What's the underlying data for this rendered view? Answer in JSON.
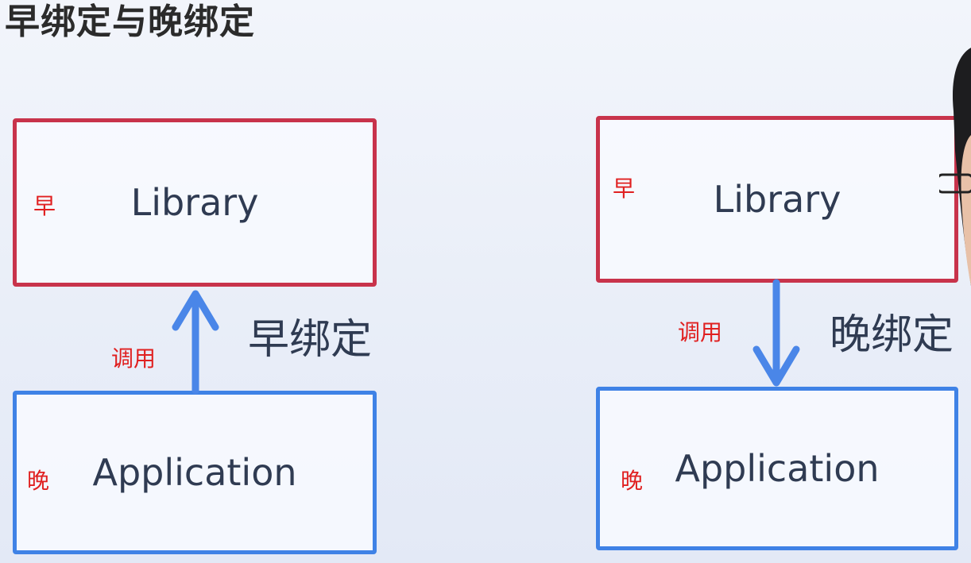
{
  "title": "早绑定与晚绑定",
  "left": {
    "library_label": "Library",
    "application_label": "Application",
    "binding_label": "早绑定",
    "note_library": "早",
    "note_call": "调用",
    "note_application": "晚",
    "arrow_direction": "up"
  },
  "right": {
    "library_label": "Library",
    "application_label": "Application",
    "binding_label": "晚绑定",
    "note_library": "早",
    "note_call": "调用",
    "note_application": "晚",
    "arrow_direction": "down"
  },
  "colors": {
    "library_border": "#c8334b",
    "application_border": "#3f82e6",
    "arrow": "#4a86e8",
    "note_text": "#e02020"
  }
}
